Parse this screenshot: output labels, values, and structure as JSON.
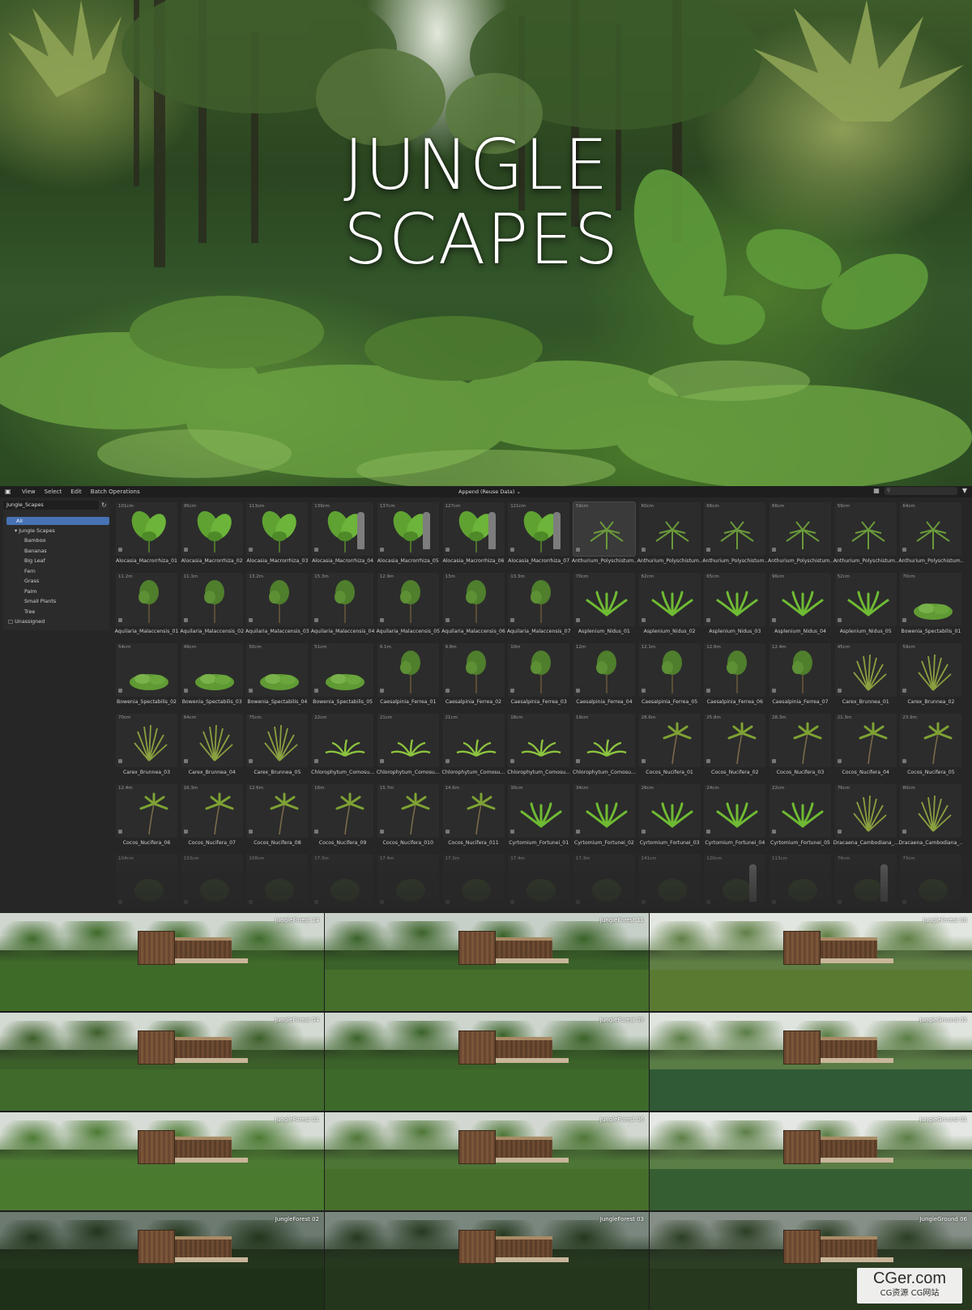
{
  "hero": {
    "title_line1": "JUNGLE",
    "title_line2": "SCAPES"
  },
  "menubar": {
    "items": [
      "View",
      "Select",
      "Edit",
      "Batch Operations"
    ],
    "import_mode": "Append (Reuse Data)"
  },
  "sidebar": {
    "library": "Jungle_Scapes",
    "all_label": "All",
    "root": "Jungle Scapes",
    "categories": [
      "Bamboo",
      "Bananas",
      "Big Leaf",
      "Fern",
      "Grass",
      "Palm",
      "Small Plants",
      "Tree"
    ],
    "unassigned": "Unassigned"
  },
  "assets": [
    {
      "name": "Alocasia_Macrorrhiza_01",
      "size": "101cm"
    },
    {
      "name": "Alocasia_Macrorrhiza_02",
      "size": "95cm"
    },
    {
      "name": "Alocasia_Macrorrhiza_03",
      "size": "113cm"
    },
    {
      "name": "Alocasia_Macrorrhiza_04",
      "size": "139cm"
    },
    {
      "name": "Alocasia_Macrorrhiza_05",
      "size": "137cm"
    },
    {
      "name": "Alocasia_Macrorrhiza_06",
      "size": "127cm"
    },
    {
      "name": "Alocasia_Macrorrhiza_07",
      "size": "121cm"
    },
    {
      "name": "Anthurium_Polyschistum...",
      "size": "59cm"
    },
    {
      "name": "Anthurium_Polyschistum...",
      "size": "60cm"
    },
    {
      "name": "Anthurium_Polyschistum...",
      "size": "66cm"
    },
    {
      "name": "Anthurium_Polyschistum...",
      "size": "66cm"
    },
    {
      "name": "Anthurium_Polyschistum...",
      "size": "59cm"
    },
    {
      "name": "Anthurium_Polyschistum...",
      "size": "64cm"
    },
    {
      "name": "Aquilaria_Malaccensis_01",
      "size": "11.2m"
    },
    {
      "name": "Aquilaria_Malaccensis_02",
      "size": "11.1m"
    },
    {
      "name": "Aquilaria_Malaccensis_03",
      "size": "13.2m"
    },
    {
      "name": "Aquilaria_Malaccensis_04",
      "size": "15.3m"
    },
    {
      "name": "Aquilaria_Malaccensis_05",
      "size": "12.9m"
    },
    {
      "name": "Aquilaria_Malaccensis_06",
      "size": "13m"
    },
    {
      "name": "Aquilaria_Malaccensis_07",
      "size": "13.3m"
    },
    {
      "name": "Asplenium_Nidus_01",
      "size": "70cm"
    },
    {
      "name": "Asplenium_Nidus_02",
      "size": "62cm"
    },
    {
      "name": "Asplenium_Nidus_03",
      "size": "65cm"
    },
    {
      "name": "Asplenium_Nidus_04",
      "size": "96cm"
    },
    {
      "name": "Asplenium_Nidus_05",
      "size": "52cm"
    },
    {
      "name": "Bowenia_Spectabilis_01",
      "size": "70cm"
    },
    {
      "name": "Bowenia_Spectabilis_02",
      "size": "54cm"
    },
    {
      "name": "Bowenia_Spectabilis_03",
      "size": "49cm"
    },
    {
      "name": "Bowenia_Spectabilis_04",
      "size": "50cm"
    },
    {
      "name": "Bowenia_Spectabilis_05",
      "size": "51cm"
    },
    {
      "name": "Caesalpinia_Ferrea_01",
      "size": "9.1m"
    },
    {
      "name": "Caesalpinia_Ferrea_02",
      "size": "9.8m"
    },
    {
      "name": "Caesalpinia_Ferrea_03",
      "size": "10m"
    },
    {
      "name": "Caesalpinia_Ferrea_04",
      "size": "12m"
    },
    {
      "name": "Caesalpinia_Ferrea_05",
      "size": "12.1m"
    },
    {
      "name": "Caesalpinia_Ferrea_06",
      "size": "12.6m"
    },
    {
      "name": "Caesalpinia_Ferrea_07",
      "size": "12.4m"
    },
    {
      "name": "Carex_Brunnea_01",
      "size": "45cm"
    },
    {
      "name": "Carex_Brunnea_02",
      "size": "59cm"
    },
    {
      "name": "Carex_Brunnea_03",
      "size": "70cm"
    },
    {
      "name": "Carex_Brunnea_04",
      "size": "64cm"
    },
    {
      "name": "Carex_Brunnea_05",
      "size": "75cm"
    },
    {
      "name": "Chlorophytum_Comosu...",
      "size": "22cm"
    },
    {
      "name": "Chlorophytum_Comosu...",
      "size": "21cm"
    },
    {
      "name": "Chlorophytum_Comosu...",
      "size": "21cm"
    },
    {
      "name": "Chlorophytum_Comosu...",
      "size": "18cm"
    },
    {
      "name": "Chlorophytum_Comosu...",
      "size": "19cm"
    },
    {
      "name": "Cocos_Nucifera_01",
      "size": "28.6m"
    },
    {
      "name": "Cocos_Nucifera_02",
      "size": "25.8m"
    },
    {
      "name": "Cocos_Nucifera_03",
      "size": "28.3m"
    },
    {
      "name": "Cocos_Nucifera_04",
      "size": "21.3m"
    },
    {
      "name": "Cocos_Nucifera_05",
      "size": "23.9m"
    },
    {
      "name": "Cocos_Nucifera_06",
      "size": "12.4m"
    },
    {
      "name": "Cocos_Nucifera_07",
      "size": "16.3m"
    },
    {
      "name": "Cocos_Nucifera_08",
      "size": "12.6m"
    },
    {
      "name": "Cocos_Nucifera_09",
      "size": "16m"
    },
    {
      "name": "Cocos_Nucifera_010",
      "size": "15.7m"
    },
    {
      "name": "Cocos_Nucifera_011",
      "size": "14.6m"
    },
    {
      "name": "Cyrtomium_Fortunei_01",
      "size": "30cm"
    },
    {
      "name": "Cyrtomium_Fortunei_02",
      "size": "34cm"
    },
    {
      "name": "Cyrtomium_Fortunei_03",
      "size": "26cm"
    },
    {
      "name": "Cyrtomium_Fortunei_04",
      "size": "24cm"
    },
    {
      "name": "Cyrtomium_Fortunei_05",
      "size": "22cm"
    },
    {
      "name": "Dracaena_Cambodiana_...",
      "size": "76cm"
    },
    {
      "name": "Dracaena_Cambodiana_...",
      "size": "80cm"
    },
    {
      "name": "",
      "size": "104cm"
    },
    {
      "name": "",
      "size": "133cm"
    },
    {
      "name": "",
      "size": "108cm"
    },
    {
      "name": "",
      "size": "17.3m"
    },
    {
      "name": "",
      "size": "17.4m"
    },
    {
      "name": "",
      "size": "17.3m"
    },
    {
      "name": "",
      "size": "17.4m"
    },
    {
      "name": "",
      "size": "17.3m"
    },
    {
      "name": "",
      "size": "141cm"
    },
    {
      "name": "",
      "size": "120cm"
    },
    {
      "name": "",
      "size": "113cm"
    },
    {
      "name": "",
      "size": "74cm"
    },
    {
      "name": "",
      "size": "73cm"
    }
  ],
  "renders": [
    "JungleForest 14",
    "JungleForest 11",
    "JungleForest 08",
    "JungleForest 04",
    "JungleForest 09",
    "JungleGround 05",
    "JungleForest 01",
    "JungleForest 06",
    "JungleGround 01",
    "JungleForest 02",
    "JungleForest 03",
    "JungleGround 06"
  ],
  "watermark": {
    "main": "CGer.com",
    "sub": "CG资源 CG网站"
  },
  "colors": {
    "accent": "#4772b3",
    "panel": "#262626",
    "text": "#d0d0d0"
  }
}
